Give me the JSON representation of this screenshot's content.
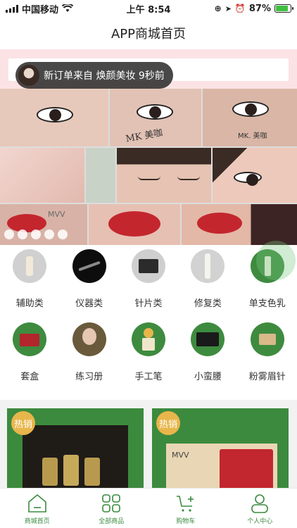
{
  "status_bar": {
    "carrier": "中国移动",
    "time": "上午 8:54",
    "battery": "87%",
    "battery_level": 0.87
  },
  "header": {
    "title": "APP商城首页"
  },
  "toast": {
    "text": "新订单来自 焕颜美妆 9秒前"
  },
  "banner": {
    "watermark_1": "MK. 美咖",
    "watermark_2": "MK 美咖",
    "watermark_3": "MVV"
  },
  "categories": [
    {
      "label": "辅助类",
      "icon": "auxiliary-product-icon"
    },
    {
      "label": "仪器类",
      "icon": "instrument-icon"
    },
    {
      "label": "针片类",
      "icon": "needle-icon"
    },
    {
      "label": "修复类",
      "icon": "repair-cream-icon"
    },
    {
      "label": "单支色乳",
      "icon": "color-pigment-icon"
    },
    {
      "label": "套盒",
      "icon": "gift-box-icon"
    },
    {
      "label": "练习册",
      "icon": "practice-book-icon"
    },
    {
      "label": "手工笔",
      "icon": "manual-pen-icon"
    },
    {
      "label": "小蛮腰",
      "icon": "waist-device-icon"
    },
    {
      "label": "粉雾眉针",
      "icon": "powder-brow-needle-icon"
    }
  ],
  "products": [
    {
      "badge": "热销"
    },
    {
      "badge": "热销",
      "brand": "MVV"
    }
  ],
  "tabbar": [
    {
      "label": "商城首页",
      "icon": "home-icon"
    },
    {
      "label": "全部商品",
      "icon": "grid-icon"
    },
    {
      "label": "购物车",
      "icon": "cart-icon"
    },
    {
      "label": "个人中心",
      "icon": "user-icon"
    }
  ],
  "colors": {
    "accent": "#3b8b3d",
    "banner_bg": "#fbe3e5",
    "hot_badge": "#e8b64b"
  }
}
